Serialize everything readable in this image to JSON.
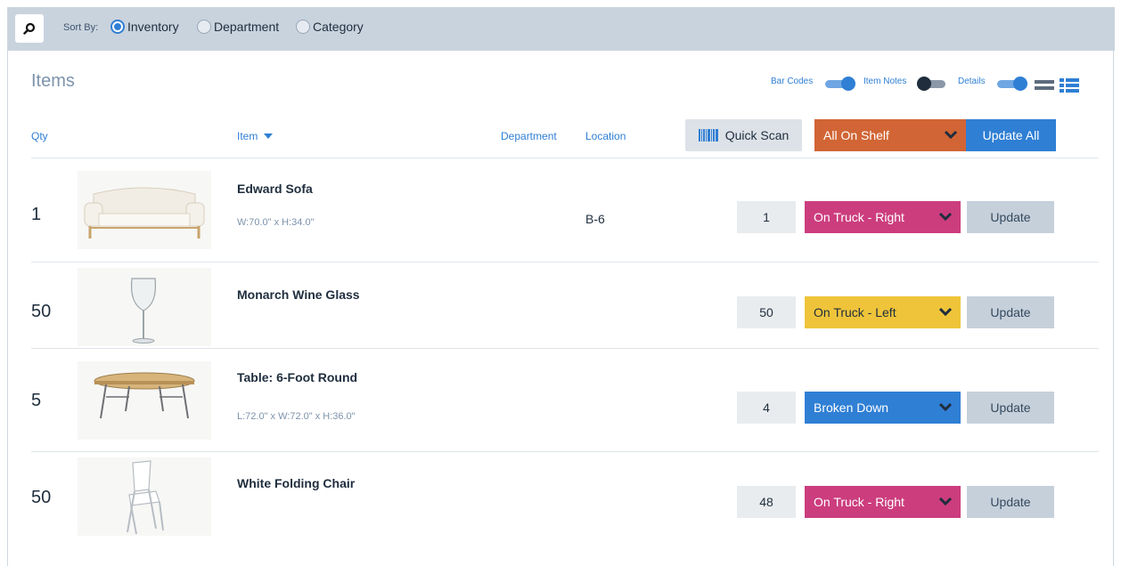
{
  "toolbar": {
    "sort_by_label": "Sort By:",
    "sort_options": [
      {
        "label": "Inventory",
        "selected": true
      },
      {
        "label": "Department",
        "selected": false
      },
      {
        "label": "Category",
        "selected": false
      }
    ]
  },
  "page_title": "Items",
  "toggles": {
    "bar_codes": {
      "label": "Bar Codes",
      "on": true
    },
    "item_notes": {
      "label": "Item Notes",
      "on": false
    },
    "details": {
      "label": "Details",
      "on": true
    }
  },
  "columns": {
    "qty": "Qty",
    "item": "Item",
    "department": "Department",
    "location": "Location"
  },
  "actions": {
    "quick_scan": "Quick Scan",
    "all_status": "All On Shelf",
    "update_all": "Update All"
  },
  "items": [
    {
      "qty": "1",
      "name": "Edward Sofa",
      "dims": "W:70.0\" x H:34.0\"",
      "location": "B-6",
      "count": "1",
      "status": "On Truck - Right",
      "status_color": "#cc3d7e",
      "update": "Update"
    },
    {
      "qty": "50",
      "name": "Monarch Wine Glass",
      "dims": "",
      "location": "",
      "count": "50",
      "status": "On Truck - Left",
      "status_color": "#efc43a",
      "update": "Update"
    },
    {
      "qty": "5",
      "name": "Table: 6-Foot Round",
      "dims": "L:72.0\" x W:72.0\" x H:36.0\"",
      "location": "",
      "count": "4",
      "status": "Broken Down",
      "status_color": "#2f7fd4",
      "update": "Update"
    },
    {
      "qty": "50",
      "name": "White Folding Chair",
      "dims": "",
      "location": "",
      "count": "48",
      "status": "On Truck - Right",
      "status_color": "#cc3d7e",
      "update": "Update"
    }
  ]
}
